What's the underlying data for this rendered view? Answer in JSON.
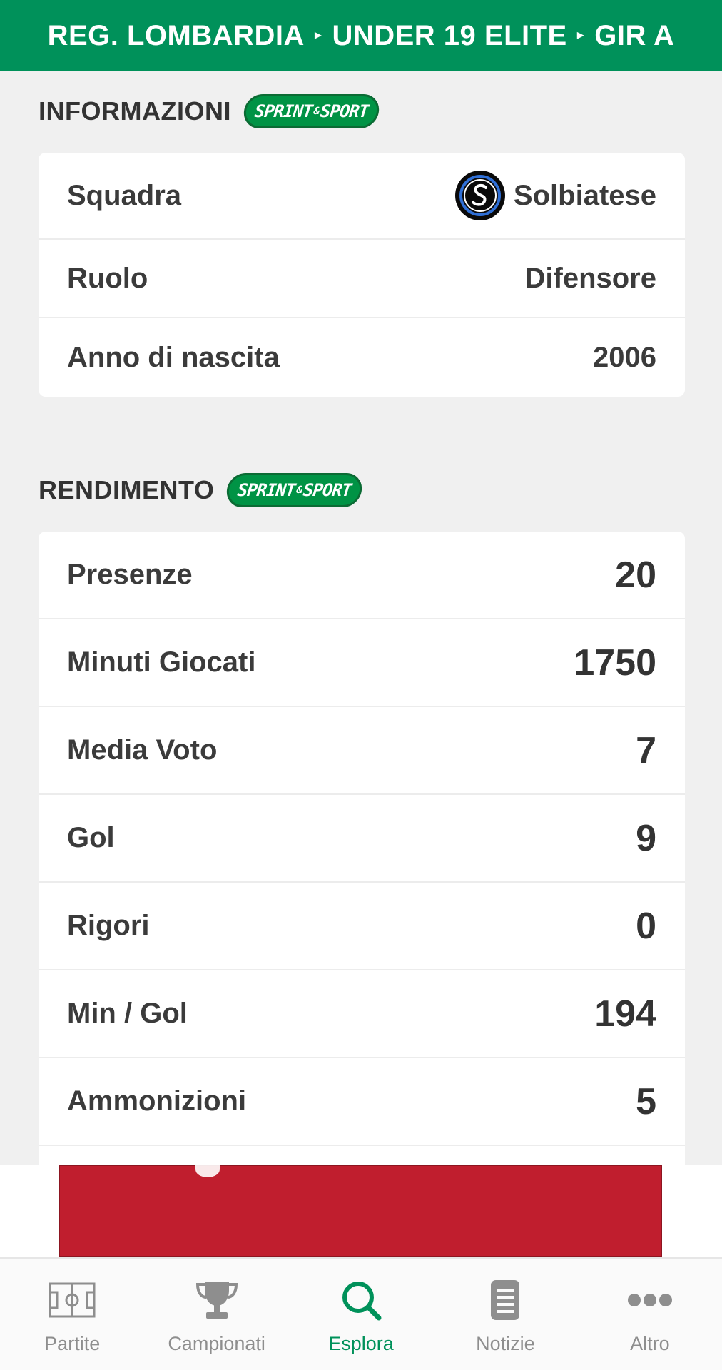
{
  "header": {
    "crumbs": [
      "REG. LOMBARDIA",
      "UNDER 19 ELITE",
      "GIR A"
    ],
    "separator": "▸"
  },
  "info_section": {
    "title": "INFORMAZIONI",
    "badge": {
      "left": "SPRINT",
      "amp": "&",
      "right": "SPORT"
    },
    "rows": [
      {
        "label": "Squadra",
        "value": "Solbiatese"
      },
      {
        "label": "Ruolo",
        "value": "Difensore"
      },
      {
        "label": "Anno di nascita",
        "value": "2006"
      }
    ]
  },
  "stats_section": {
    "title": "RENDIMENTO",
    "badge": {
      "left": "SPRINT",
      "amp": "&",
      "right": "SPORT"
    },
    "rows": [
      {
        "label": "Presenze",
        "value": "20"
      },
      {
        "label": "Minuti Giocati",
        "value": "1750"
      },
      {
        "label": "Media Voto",
        "value": "7"
      },
      {
        "label": "Gol",
        "value": "9"
      },
      {
        "label": "Rigori",
        "value": "0"
      },
      {
        "label": "Min / Gol",
        "value": "194"
      },
      {
        "label": "Ammonizioni",
        "value": "5"
      }
    ]
  },
  "bottom_nav": {
    "items": [
      {
        "label": "Partite",
        "icon": "pitch-icon"
      },
      {
        "label": "Campionati",
        "icon": "trophy-icon"
      },
      {
        "label": "Esplora",
        "icon": "search-icon",
        "active": true
      },
      {
        "label": "Notizie",
        "icon": "news-icon"
      },
      {
        "label": "Altro",
        "icon": "more-icon"
      }
    ]
  },
  "colors": {
    "brand_green": "#00915a",
    "ad_red": "#c01e2e",
    "text": "#3b3b3b",
    "inactive": "#8e8e8e"
  }
}
